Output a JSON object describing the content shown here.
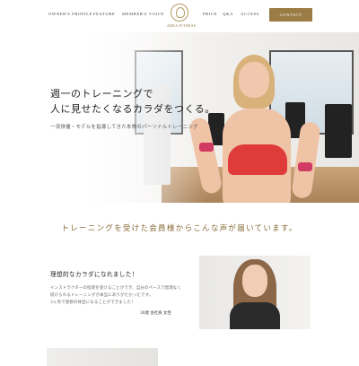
{
  "nav": {
    "items": [
      "OWNER'S PROFILE",
      "FEATURE",
      "MEMBER'S VOICE",
      "PRICE",
      "Q&A",
      "ACCESS"
    ],
    "logo_text": "AREA FITNESS",
    "contact_label": "CONTACT"
  },
  "hero": {
    "title_line1": "週一のトレーニングで",
    "title_line2": "人に見せたくなるカラダをつくる。",
    "subtitle": "一流俳優・モデルを指導してきた本物のパーソナルトレーニング"
  },
  "voices": {
    "heading": "トレーニングを受けた会員様からこんな声が届いています。",
    "item1": {
      "title": "理想的なカラダになれました！",
      "body_line1": "インストラクターの指導を受けることができ、自分のペースで無理なく",
      "body_line2": "続けられるトレーニングが本当にありがたかったです。",
      "body_line3": "3ヶ月で理想の体型になることができました！",
      "meta": "30歳 会社員 女性"
    }
  },
  "colors": {
    "accent": "#9b7c45",
    "heading_gold": "#8a6d3b"
  }
}
